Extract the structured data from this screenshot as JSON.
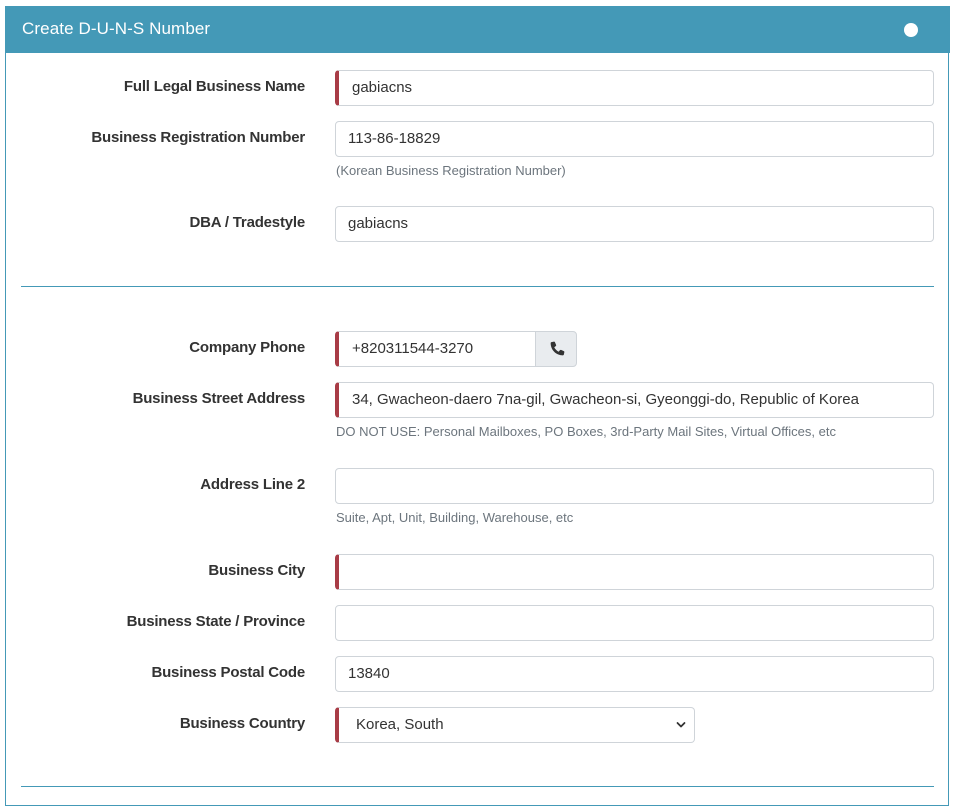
{
  "header": {
    "title": "Create D-U-N-S Number"
  },
  "icons": {
    "header_dot": "circle-icon",
    "phone": "phone-icon",
    "select_arrow": "chevron-down-icon"
  },
  "colors": {
    "header_bg": "#4499b7",
    "required_marker": "#a83c46",
    "help_text": "#6c757d"
  },
  "business": {
    "legal_name": {
      "label": "Full Legal Business Name",
      "value": "gabiacns"
    },
    "registration": {
      "label": "Business Registration Number",
      "value": "113-86-18829",
      "help": "(Korean Business Registration Number)"
    },
    "dba": {
      "label": "DBA / Tradestyle",
      "value": "gabiacns"
    }
  },
  "contact": {
    "phone": {
      "label": "Company Phone",
      "value": "+820311544-3270"
    },
    "street": {
      "label": "Business Street Address",
      "value": "34, Gwacheon-daero 7na-gil, Gwacheon-si, Gyeonggi-do, Republic of Korea",
      "help": "DO NOT USE: Personal Mailboxes, PO Boxes, 3rd-Party Mail Sites, Virtual Offices, etc"
    },
    "address2": {
      "label": "Address Line 2",
      "value": "",
      "help": "Suite, Apt, Unit, Building, Warehouse, etc"
    },
    "city": {
      "label": "Business City",
      "value": ""
    },
    "state": {
      "label": "Business State / Province",
      "value": ""
    },
    "postal": {
      "label": "Business Postal Code",
      "value": "13840"
    },
    "country": {
      "label": "Business Country",
      "value": "Korea, South"
    }
  }
}
